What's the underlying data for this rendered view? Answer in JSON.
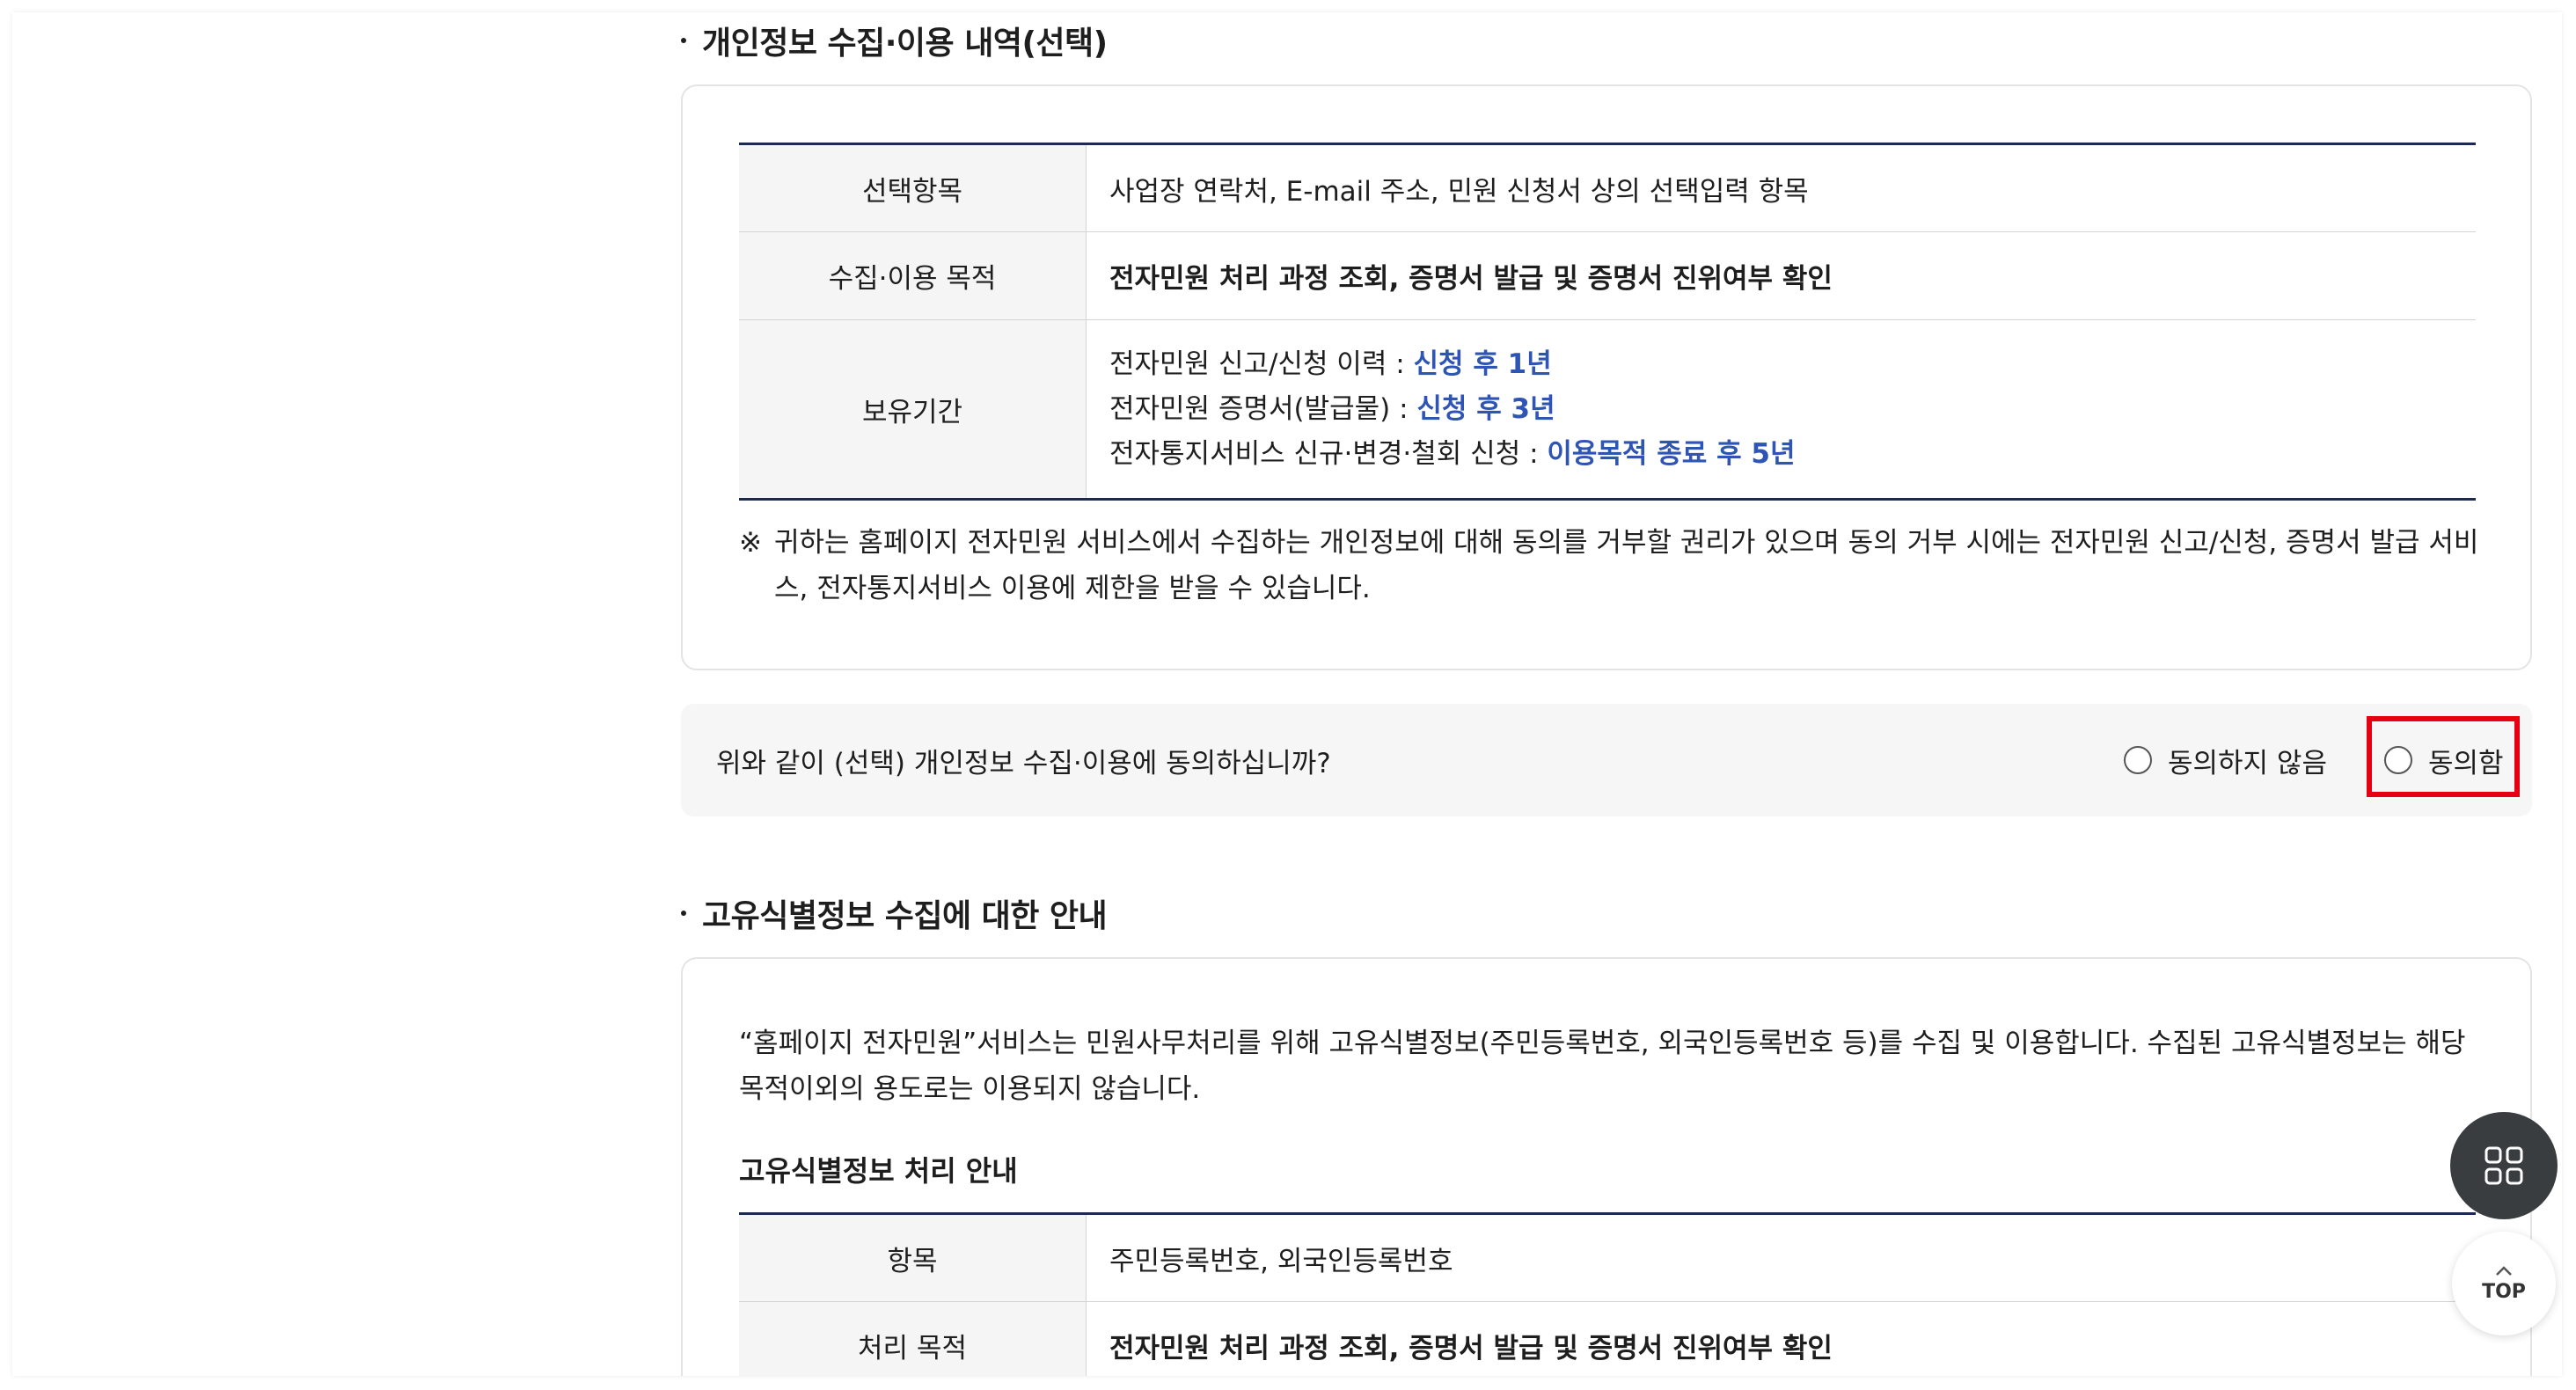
{
  "section1": {
    "title": "개인정보 수집·이용 내역(선택)",
    "rows": [
      {
        "label": "선택항목",
        "value": "사업장 연락처, E-mail 주소, 민원 신청서 상의 선택입력 항목"
      },
      {
        "label": "수집·이용 목적",
        "value": "전자민원 처리 과정 조회, 증명서 발급 및 증명서 진위여부 확인"
      },
      {
        "label": "보유기간",
        "lines": [
          {
            "prefix": "전자민원 신고/신청 이력 : ",
            "highlight": "신청 후 1년"
          },
          {
            "prefix": "전자민원 증명서(발급물) : ",
            "highlight": "신청 후 3년"
          },
          {
            "prefix": "전자통지서비스 신규·변경·철회 신청 : ",
            "highlight": "이용목적 종료 후 5년"
          }
        ]
      }
    ],
    "note_mark": "※",
    "note": "귀하는 홈페이지 전자민원 서비스에서 수집하는 개인정보에 대해 동의를 거부할 권리가 있으며 동의 거부 시에는 전자민원 신고/신청, 증명서 발급 서비스, 전자통지서비스 이용에 제한을 받을 수 있습니다."
  },
  "consent": {
    "question": "위와 같이 (선택) 개인정보 수집·이용에 동의하십니까?",
    "disagree_label": "동의하지 않음",
    "agree_label": "동의함",
    "highlight_color": "#e60012"
  },
  "section2": {
    "title": "고유식별정보 수집에 대한 안내",
    "intro": "“홈페이지 전자민원”서비스는 민원사무처리를 위해 고유식별정보(주민등록번호, 외국인등록번호 등)를 수집 및 이용합니다. 수집된 고유식별정보는 해당 목적이외의 용도로는 이용되지 않습니다.",
    "subheading": "고유식별정보 처리 안내",
    "rows": [
      {
        "label": "항목",
        "value": "주민등록번호, 외국인등록번호"
      },
      {
        "label": "처리 목적",
        "value": "전자민원 처리 과정 조회, 증명서 발급 및 증명서 진위여부 확인"
      }
    ]
  },
  "floating": {
    "menu_icon": "grid-icon",
    "top_icon": "chevron-up-icon",
    "top_label": "TOP"
  },
  "colors": {
    "accent_blue": "#2e54b4",
    "table_border": "#1b2a4e",
    "fab_dark": "#3a3d40"
  }
}
